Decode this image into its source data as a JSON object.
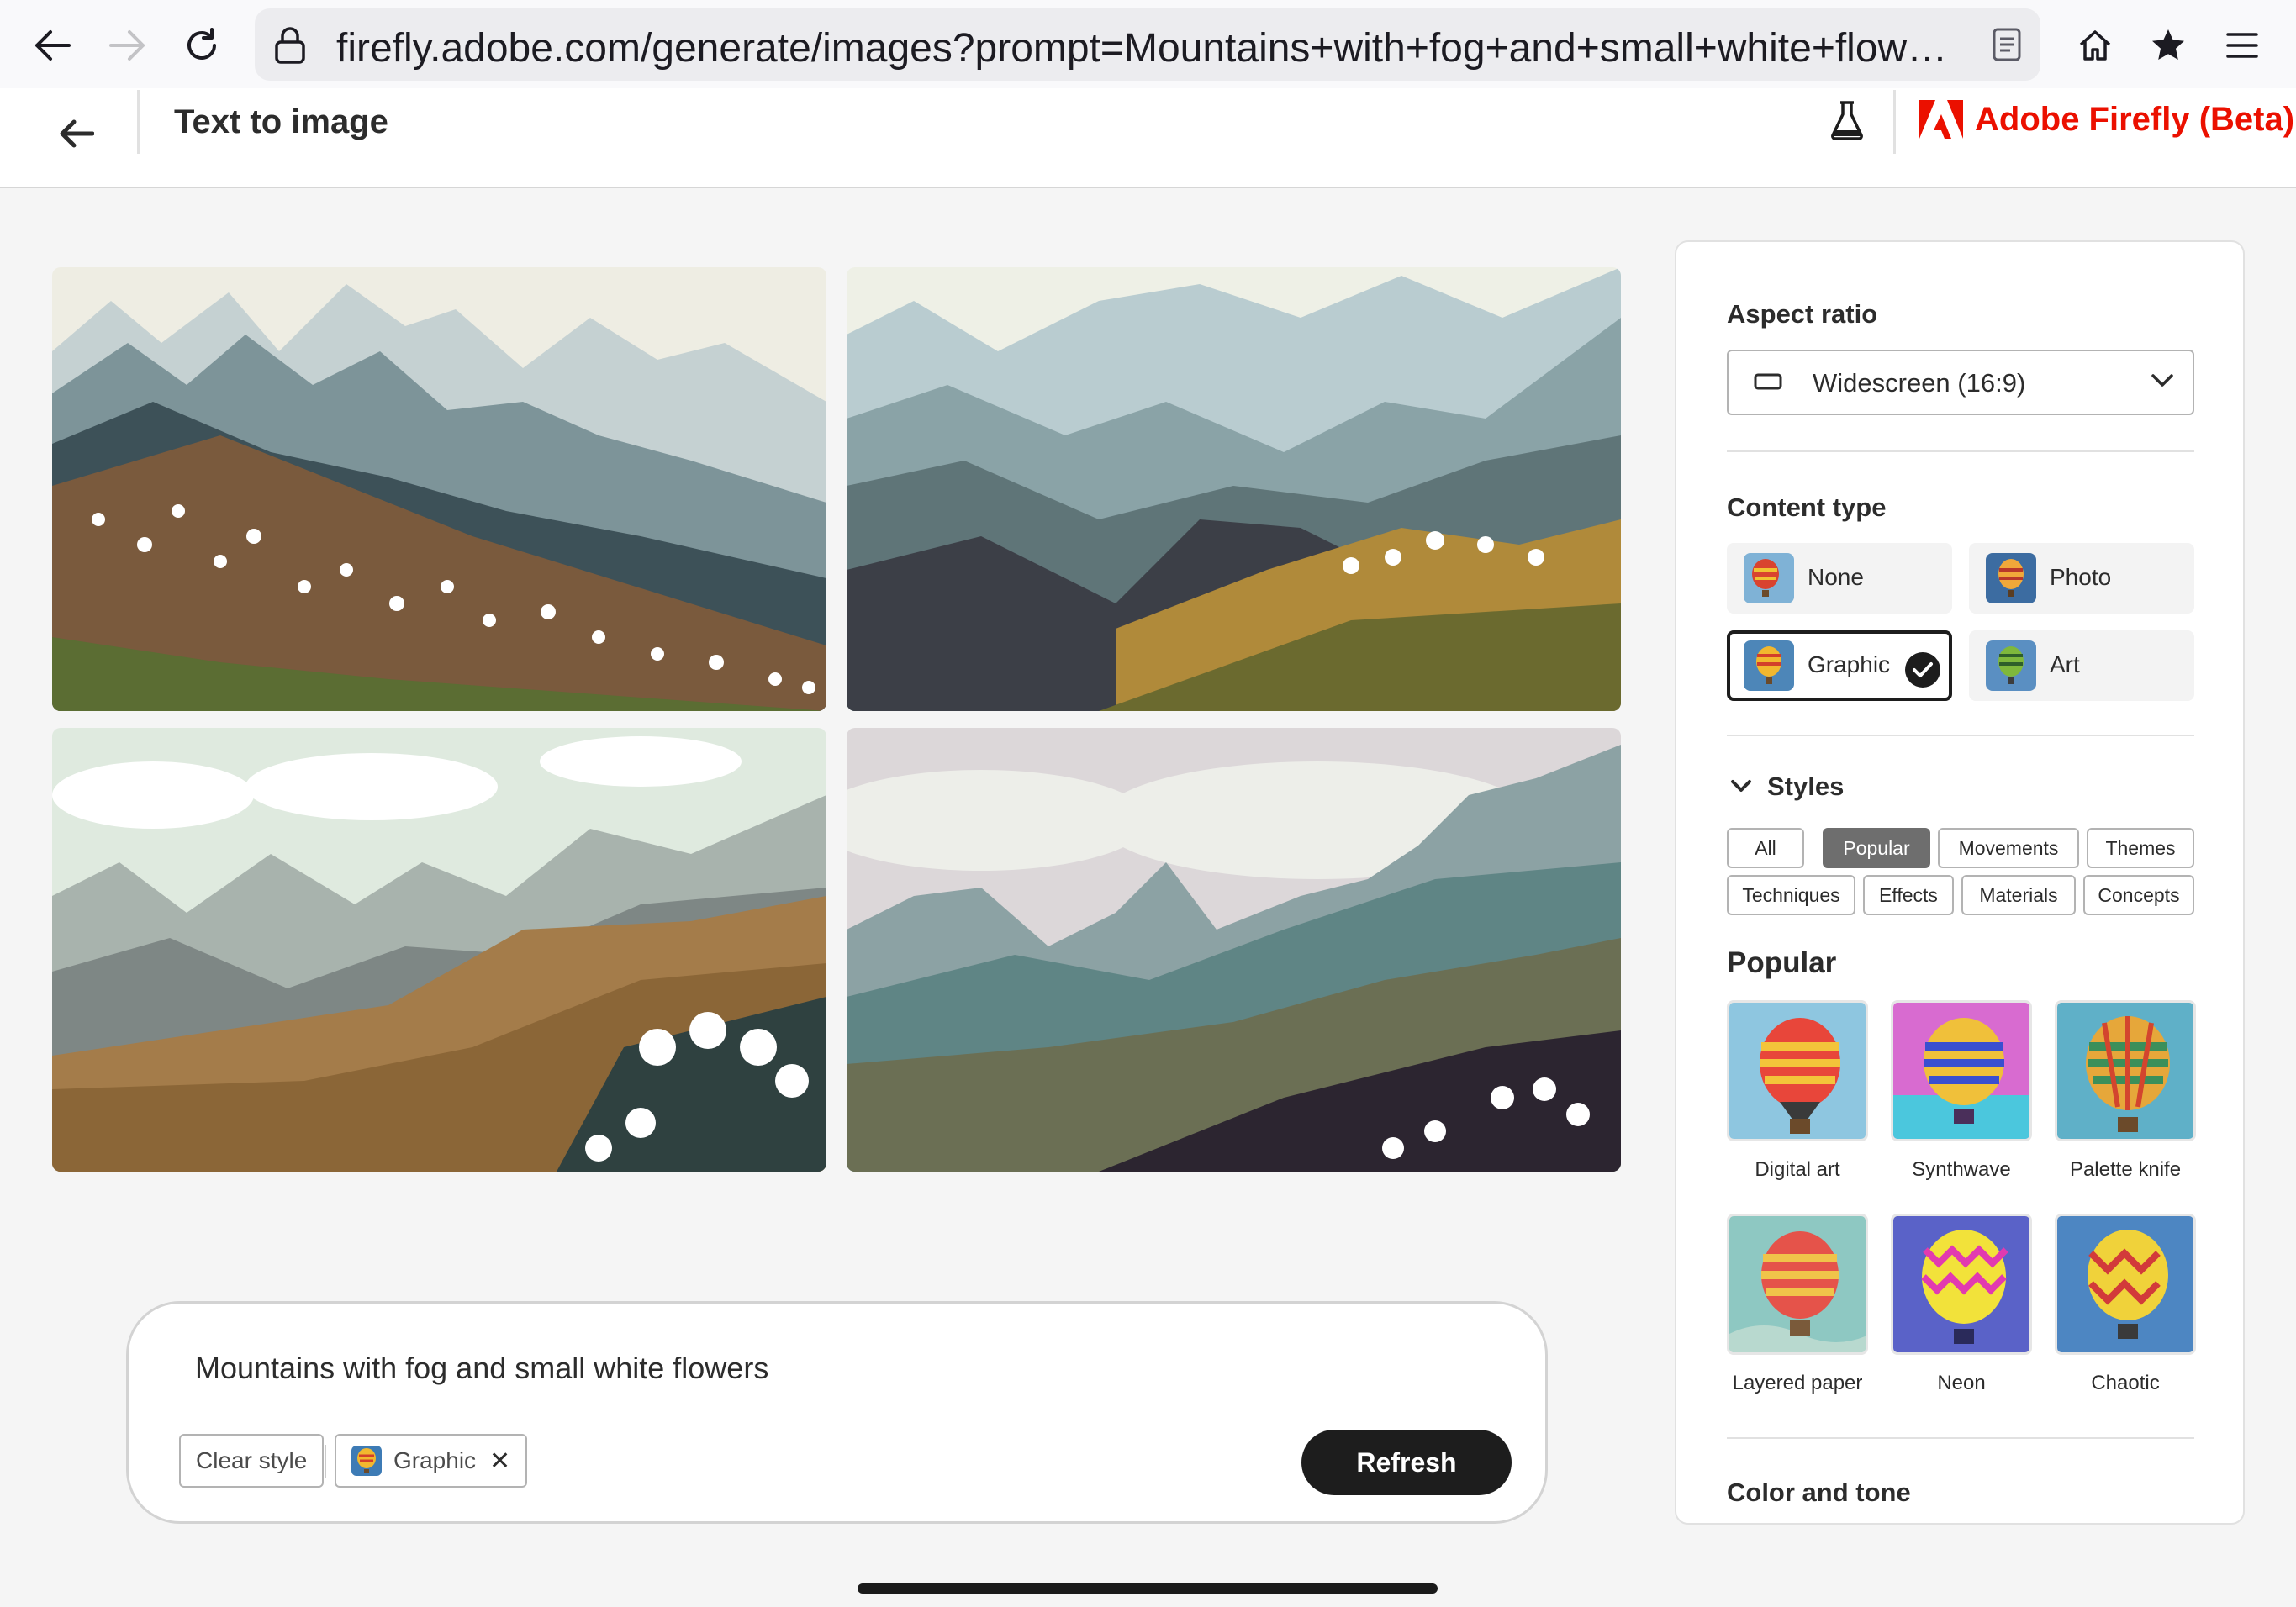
{
  "browser": {
    "url": "firefly.adobe.com/generate/images?prompt=Mountains+with+fog+and+small+white+flowers&st..."
  },
  "header": {
    "title": "Text to image",
    "brand": "Adobe Firefly (Beta)",
    "brand_color": "#eb1000"
  },
  "gallery": {
    "images": [
      "image-1",
      "image-2",
      "image-3",
      "image-4"
    ]
  },
  "prompt": {
    "text": "Mountains with fog and small white flowers",
    "clear_style_label": "Clear style",
    "active_style_chip": "Graphic",
    "refresh_label": "Refresh"
  },
  "panel": {
    "aspect_ratio": {
      "label": "Aspect ratio",
      "value": "Widescreen (16:9)"
    },
    "content_type": {
      "label": "Content type",
      "options": [
        "None",
        "Photo",
        "Graphic",
        "Art"
      ],
      "selected": "Graphic"
    },
    "styles": {
      "label": "Styles",
      "tabs": [
        "All",
        "Popular",
        "Movements",
        "Themes",
        "Techniques",
        "Effects",
        "Materials",
        "Concepts"
      ],
      "active_tab": "Popular"
    },
    "popular": {
      "label": "Popular",
      "items": [
        "Digital art",
        "Synthwave",
        "Palette knife",
        "Layered paper",
        "Neon",
        "Chaotic"
      ]
    },
    "color_and_tone": {
      "label": "Color and tone"
    }
  }
}
